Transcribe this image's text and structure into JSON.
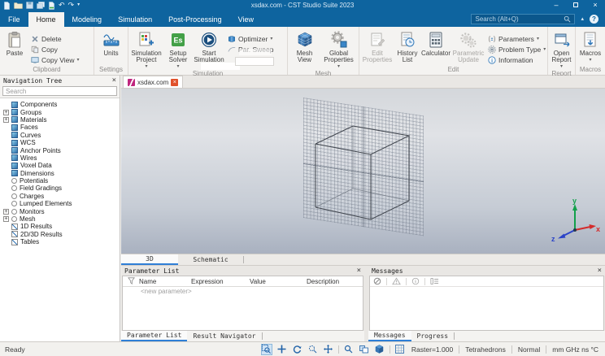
{
  "window": {
    "title": "xsdax.com - CST Studio Suite 2023",
    "minimize": "–",
    "close": "×",
    "qat_icons": [
      "new-file",
      "open-file",
      "save",
      "save-all",
      "import",
      "undo",
      "redo",
      "customize"
    ]
  },
  "menu": {
    "tabs": [
      "File",
      "Home",
      "Modeling",
      "Simulation",
      "Post-Processing",
      "View"
    ],
    "active_tab": "Home",
    "search_placeholder": "Search (Alt+Q)",
    "help": "?"
  },
  "ribbon": {
    "clipboard": {
      "paste": "Paste",
      "delete": "Delete",
      "copy": "Copy",
      "copy_view": "Copy View",
      "group": "Clipboard"
    },
    "settings": {
      "units": "Units",
      "group": "Settings"
    },
    "simulation": {
      "simulation_project": "Simulation Project",
      "setup_solver": "Setup Solver",
      "setup_solver_abbr": "Es",
      "start_simulation": "Start Simulation",
      "optimizer": "Optimizer",
      "par_sweep": "Par. Sweep",
      "group": "Simulation"
    },
    "mesh": {
      "mesh_view": "Mesh View",
      "global_properties": "Global Properties",
      "group": "Mesh"
    },
    "edit": {
      "edit_properties": "Edit Properties",
      "history_list": "History List",
      "calculator": "Calculator",
      "parametric_update": "Parametric Update",
      "parameters": "Parameters",
      "problem_type": "Problem Type",
      "information": "Information",
      "group": "Edit"
    },
    "report": {
      "open_report": "Open Report",
      "group": "Report"
    },
    "macros": {
      "macros": "Macros",
      "group": "Macros"
    }
  },
  "nav": {
    "title": "Navigation Tree",
    "close": "×",
    "search_placeholder": "Search",
    "items": [
      {
        "label": "Components",
        "icon": "cube",
        "expander": ""
      },
      {
        "label": "Groups",
        "icon": "cube",
        "expander": "+"
      },
      {
        "label": "Materials",
        "icon": "cube",
        "expander": "+"
      },
      {
        "label": "Faces",
        "icon": "cube",
        "expander": ""
      },
      {
        "label": "Curves",
        "icon": "cube",
        "expander": ""
      },
      {
        "label": "WCS",
        "icon": "cube",
        "expander": ""
      },
      {
        "label": "Anchor Points",
        "icon": "cube",
        "expander": ""
      },
      {
        "label": "Wires",
        "icon": "cube",
        "expander": ""
      },
      {
        "label": "Voxel Data",
        "icon": "cube",
        "expander": ""
      },
      {
        "label": "Dimensions",
        "icon": "cube",
        "expander": ""
      },
      {
        "label": "Potentials",
        "icon": "circle",
        "expander": ""
      },
      {
        "label": "Field Gradings",
        "icon": "circle",
        "expander": ""
      },
      {
        "label": "Charges",
        "icon": "circle",
        "expander": ""
      },
      {
        "label": "Lumped Elements",
        "icon": "circle",
        "expander": ""
      },
      {
        "label": "Monitors",
        "icon": "circle",
        "expander": "+"
      },
      {
        "label": "Mesh",
        "icon": "circle",
        "expander": "+"
      },
      {
        "label": "1D Results",
        "icon": "chart",
        "expander": ""
      },
      {
        "label": "2D/3D Results",
        "icon": "chart",
        "expander": ""
      },
      {
        "label": "Tables",
        "icon": "chart",
        "expander": ""
      }
    ]
  },
  "document": {
    "tab_label": "xsdax.com",
    "tab_close": "×"
  },
  "viewport": {
    "axis_x": "x",
    "axis_y": "y",
    "axis_z": "z",
    "axis_x_color": "#d42b2b",
    "axis_y_color": "#12a04a",
    "axis_z_color": "#2b43c8"
  },
  "view_tabs": {
    "tab_3d": "3D",
    "tab_schematic": "Schematic"
  },
  "params": {
    "title": "Parameter List",
    "close": "×",
    "columns": [
      "Name",
      "Expression",
      "Value",
      "Description"
    ],
    "new_parameter": "<new parameter>",
    "tab_parameter_list": "Parameter List",
    "tab_result_navigator": "Result Navigator"
  },
  "messages": {
    "title": "Messages",
    "close": "×",
    "toolbar_icons": [
      "errors-filter",
      "warnings-filter",
      "info-filter",
      "log-view"
    ],
    "tab_messages": "Messages",
    "tab_progress": "Progress"
  },
  "status": {
    "ready": "Ready",
    "tools": [
      "zoom-select",
      "move",
      "rotate",
      "zoom-lasso",
      "pan",
      "zoom",
      "split-view",
      "bounding-box",
      "raster-grid"
    ],
    "raster": "Raster=1.000",
    "mesh_type": "Tetrahedrons",
    "mode": "Normal",
    "units": "mm GHz ns °C"
  }
}
